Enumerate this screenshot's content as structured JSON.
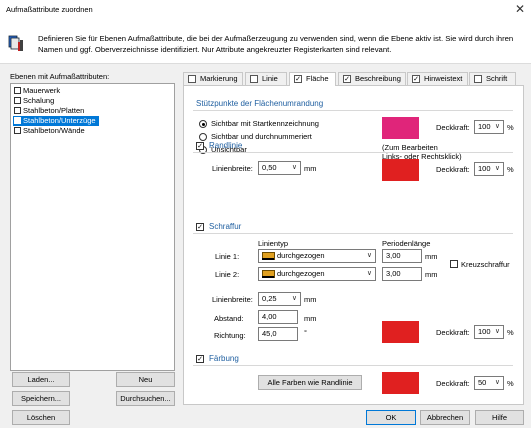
{
  "window": {
    "title": "Aufmaßattribute zuordnen",
    "close_glyph": "✕"
  },
  "info": {
    "icon": "layer-attributes-icon",
    "text": "Definieren Sie für Ebenen Aufmaßattribute, die bei der Aufmaßerzeugung zu verwenden sind, wenn die Ebene aktiv ist. Sie wird durch ihren Namen und ggf. Oberverzeichnisse identifiziert. Nur Attribute angekreuzter Registerkarten sind relevant."
  },
  "layers": {
    "label": "Ebenen mit Aufmaßattributen:",
    "items": [
      {
        "label": "Mauerwerk",
        "selected": false
      },
      {
        "label": "Schalung",
        "selected": false
      },
      {
        "label": "Stahlbeton/Platten",
        "selected": false
      },
      {
        "label": "Stahlbeton/Unterzüge",
        "selected": true
      },
      {
        "label": "Stahlbeton/Wände",
        "selected": false
      }
    ]
  },
  "left_buttons": {
    "load": "Laden...",
    "new": "Neu",
    "save": "Speichern...",
    "browse": "Durchsuchen...",
    "delete": "Löschen"
  },
  "tabs": [
    {
      "label": "Markierung",
      "checked": false,
      "active": false
    },
    {
      "label": "Linie",
      "checked": false,
      "active": false
    },
    {
      "label": "Fläche",
      "checked": true,
      "active": true
    },
    {
      "label": "Beschreibung",
      "checked": true,
      "active": false
    },
    {
      "label": "Hinweistext",
      "checked": true,
      "active": false
    },
    {
      "label": "Schrift",
      "checked": false,
      "active": false
    }
  ],
  "vertices": {
    "title": "Stützpunkte der Flächenumrandung",
    "options": [
      {
        "label": "Sichtbar mit Startkennzeichnung",
        "selected": true
      },
      {
        "label": "Sichtbar und durchnummeriert",
        "selected": false
      },
      {
        "label": "Unsichtbar",
        "selected": false
      }
    ],
    "color": "#e0257a",
    "hint": "(Zum Bearbeiten\nLinks- oder Rechtsklick)",
    "opacity_label": "Deckkraft:",
    "opacity": "100",
    "opacity_unit": "%"
  },
  "border": {
    "title": "Randlinie",
    "checked": true,
    "width_label": "Linienbreite:",
    "width": "0,50",
    "width_unit": "mm",
    "color": "#e02020",
    "opacity_label": "Deckkraft:",
    "opacity": "100",
    "opacity_unit": "%"
  },
  "hatch": {
    "title": "Schraffur",
    "checked": true,
    "linetype_header": "Linientyp",
    "period_header": "Periodenlänge",
    "line1_label": "Linie 1:",
    "line1_type": "durchgezogen",
    "line1_period": "3,00",
    "line2_label": "Linie 2:",
    "line2_type": "durchgezogen",
    "line2_period": "3,00",
    "period_unit": "mm",
    "cross_label": "Kreuzschraffur",
    "cross_checked": false,
    "width_label": "Linienbreite:",
    "width": "0,25",
    "width_unit": "mm",
    "spacing_label": "Abstand:",
    "spacing": "4,00",
    "spacing_unit": "mm",
    "direction_label": "Richtung:",
    "direction": "45,0",
    "direction_unit": "°",
    "color": "#e02020",
    "opacity_label": "Deckkraft:",
    "opacity": "100",
    "opacity_unit": "%"
  },
  "fill": {
    "title": "Färbung",
    "checked": true,
    "same_colors_button": "Alle Farben wie Randlinie",
    "color": "#e02020",
    "opacity_label": "Deckkraft:",
    "opacity": "50",
    "opacity_unit": "%"
  },
  "footer": {
    "ok": "OK",
    "cancel": "Abbrechen",
    "help": "Hilfe"
  }
}
